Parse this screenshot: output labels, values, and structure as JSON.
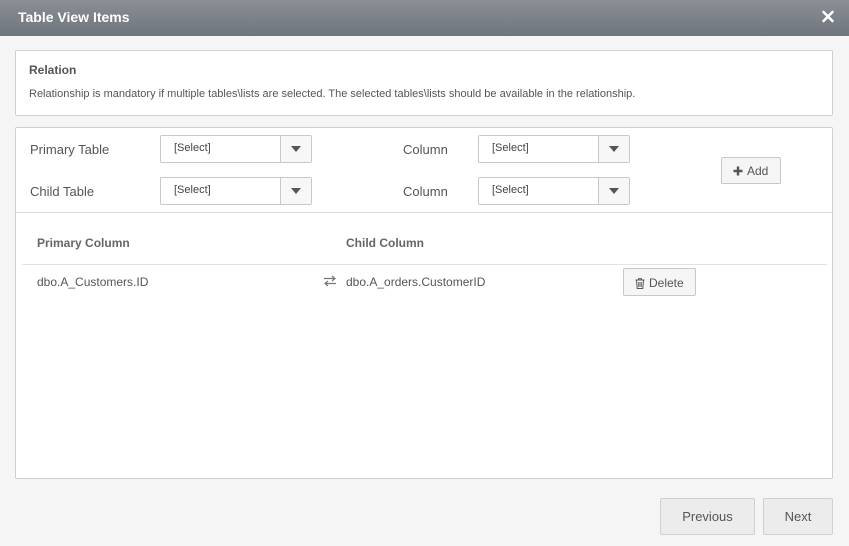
{
  "window": {
    "title": "Table View Items",
    "close_icon": "close-icon"
  },
  "relation": {
    "heading": "Relation",
    "description": "Relationship is mandatory if multiple tables\\lists are selected. The selected tables\\lists should be available in the relationship."
  },
  "form": {
    "primary_table_label": "Primary Table",
    "primary_table_value": "[Select]",
    "primary_column_label": "Column",
    "primary_column_value": "[Select]",
    "child_table_label": "Child Table",
    "child_table_value": "[Select]",
    "child_column_label": "Column",
    "child_column_value": "[Select]",
    "add_label": "Add"
  },
  "table": {
    "headers": {
      "primary": "Primary Column",
      "child": "Child Column"
    },
    "rows": [
      {
        "primary": "dbo.A_Customers.ID",
        "child": "dbo.A_orders.CustomerID",
        "delete_label": "Delete"
      }
    ]
  },
  "footer": {
    "previous_label": "Previous",
    "next_label": "Next"
  }
}
